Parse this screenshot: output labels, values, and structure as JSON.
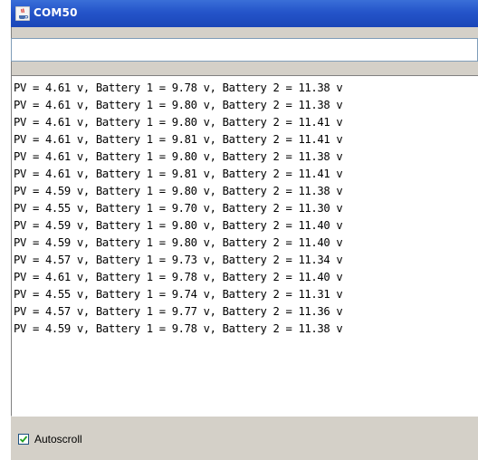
{
  "window": {
    "title": "COM50",
    "title_icon": "java-cup-icon",
    "title_bar_color": "#2454c9"
  },
  "send_input": {
    "value": ""
  },
  "console": {
    "lines": [
      "PV = 4.61 v, Battery 1 = 9.78 v, Battery 2 = 11.38 v",
      "PV = 4.61 v, Battery 1 = 9.80 v, Battery 2 = 11.38 v",
      "PV = 4.61 v, Battery 1 = 9.80 v, Battery 2 = 11.41 v",
      "PV = 4.61 v, Battery 1 = 9.81 v, Battery 2 = 11.41 v",
      "PV = 4.61 v, Battery 1 = 9.80 v, Battery 2 = 11.38 v",
      "PV = 4.61 v, Battery 1 = 9.81 v, Battery 2 = 11.41 v",
      "PV = 4.59 v, Battery 1 = 9.80 v, Battery 2 = 11.38 v",
      "PV = 4.55 v, Battery 1 = 9.70 v, Battery 2 = 11.30 v",
      "PV = 4.59 v, Battery 1 = 9.80 v, Battery 2 = 11.40 v",
      "PV = 4.59 v, Battery 1 = 9.80 v, Battery 2 = 11.40 v",
      "PV = 4.57 v, Battery 1 = 9.73 v, Battery 2 = 11.34 v",
      "PV = 4.61 v, Battery 1 = 9.78 v, Battery 2 = 11.40 v",
      "PV = 4.55 v, Battery 1 = 9.74 v, Battery 2 = 11.31 v",
      "PV = 4.57 v, Battery 1 = 9.77 v, Battery 2 = 11.36 v",
      "PV = 4.59 v, Battery 1 = 9.78 v, Battery 2 = 11.38 v"
    ]
  },
  "autoscroll": {
    "label": "Autoscroll",
    "checked": true
  }
}
